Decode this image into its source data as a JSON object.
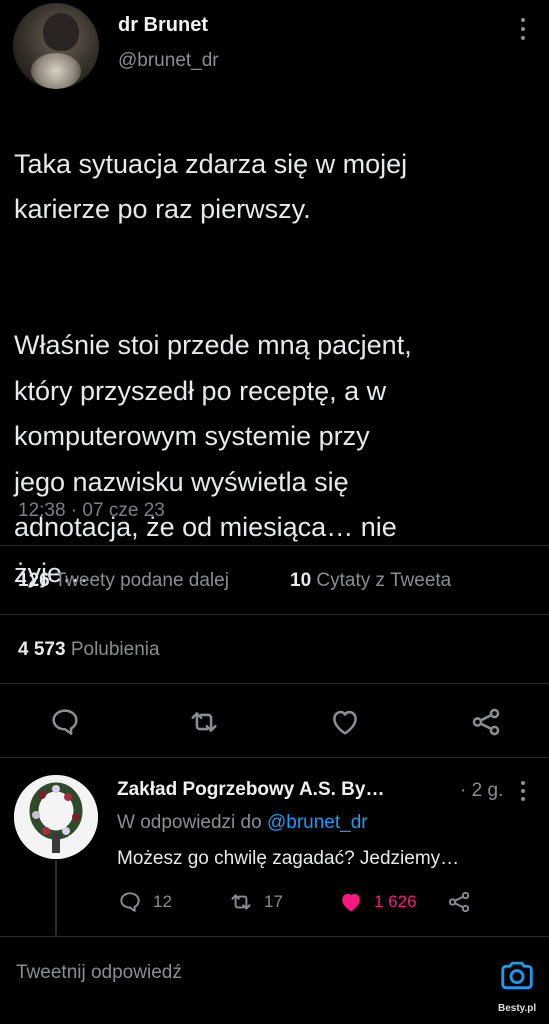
{
  "tweet": {
    "author_name": "dr Brunet",
    "author_handle": "@brunet_dr",
    "text_p1": "Taka sytuacja zdarza się w mojej\nkarierze po raz pierwszy.",
    "text_p2": "Właśnie stoi przede mną pacjent,\nktóry przyszedł po receptę, a w\nkomputerowym systemie przy\njego nazwisku wyświetla się\nadnotacja, że od miesiąca… nie\nżyje…",
    "timestamp": "12:38 · 07 cze 23"
  },
  "stats": {
    "retweets_count": "126",
    "retweets_label": "Tweety podane dalej",
    "quotes_count": "10",
    "quotes_label": "Cytaty z Tweeta",
    "likes_count": "4 573",
    "likes_label": "Polubienia"
  },
  "actions": [
    "reply-icon",
    "retweet-icon",
    "like-icon",
    "share-icon"
  ],
  "reply": {
    "author_name": "Zakład Pogrzebowy A.S. By…",
    "age": "· 2 g.",
    "in_reply_prefix": "W odpowiedzi do",
    "in_reply_handle": "@brunet_dr",
    "text": "Możesz go chwilę zagadać? Jedziemy…",
    "replies": "12",
    "retweets": "17",
    "likes": "1 626"
  },
  "compose": {
    "placeholder": "Tweetnij odpowiedź"
  },
  "watermark": "Besty.pl",
  "colors": {
    "background": "#000000",
    "accent": "#1d9bf0",
    "like": "#f91880",
    "muted": "#8a8d91"
  }
}
